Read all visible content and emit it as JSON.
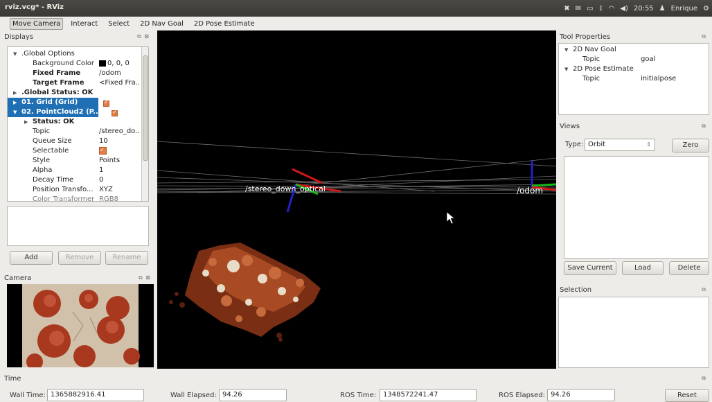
{
  "window": {
    "title": "rviz.vcg* - RViz"
  },
  "tray": {
    "time": "20:55",
    "user": "Enrique"
  },
  "toolbar": {
    "tools": [
      "Move Camera",
      "Interact",
      "Select",
      "2D Nav Goal",
      "2D Pose Estimate"
    ],
    "active": "Move Camera"
  },
  "displays": {
    "title": "Displays",
    "rows": [
      {
        "key": ".Global Options",
        "value": ""
      },
      {
        "key": "Background Color",
        "value": "0, 0, 0"
      },
      {
        "key": "Fixed Frame",
        "value": "/odom"
      },
      {
        "key": "Target Frame",
        "value": "<Fixed Fra.."
      },
      {
        "key": ".Global Status: OK",
        "value": ""
      },
      {
        "key": "01. Grid (Grid)",
        "value": ""
      },
      {
        "key": "02. PointCloud2 (P...",
        "value": ""
      },
      {
        "key": "Status: OK",
        "value": ""
      },
      {
        "key": "Topic",
        "value": "/stereo_do.."
      },
      {
        "key": "Queue Size",
        "value": "10"
      },
      {
        "key": "Selectable",
        "value": ""
      },
      {
        "key": "Style",
        "value": "Points"
      },
      {
        "key": "Alpha",
        "value": "1"
      },
      {
        "key": "Decay Time",
        "value": "0"
      },
      {
        "key": "Position Transfo...",
        "value": "XYZ"
      },
      {
        "key": "Color Transformer",
        "value": "RGB8"
      }
    ],
    "buttons": {
      "add": "Add",
      "remove": "Remove",
      "rename": "Rename"
    }
  },
  "camera": {
    "title": "Camera"
  },
  "view3d": {
    "frame_label_1": "/stereo_down_optical",
    "frame_label_2": "/odom"
  },
  "tool_properties": {
    "title": "Tool Properties",
    "rows": [
      {
        "key": "2D Nav Goal",
        "value": ""
      },
      {
        "key": "Topic",
        "value": "goal"
      },
      {
        "key": "2D Pose Estimate",
        "value": ""
      },
      {
        "key": "Topic",
        "value": "initialpose"
      }
    ]
  },
  "views": {
    "title": "Views",
    "type_label": "Type:",
    "type_value": "Orbit",
    "zero_label": "Zero",
    "buttons": {
      "save": "Save Current",
      "load": "Load",
      "delete": "Delete"
    }
  },
  "selection": {
    "title": "Selection"
  },
  "time": {
    "title": "Time",
    "wall_time_label": "Wall Time:",
    "wall_time": "1365882916.41",
    "wall_elapsed_label": "Wall Elapsed:",
    "wall_elapsed": "94.26",
    "ros_time_label": "ROS Time:",
    "ros_time": "1348572241.47",
    "ros_elapsed_label": "ROS Elapsed:",
    "ros_elapsed": "94.26",
    "reset_label": "Reset"
  },
  "colors": {
    "selection": "#1f6fb5",
    "checkbox": "#e07d47",
    "view_bg": "#000000"
  }
}
